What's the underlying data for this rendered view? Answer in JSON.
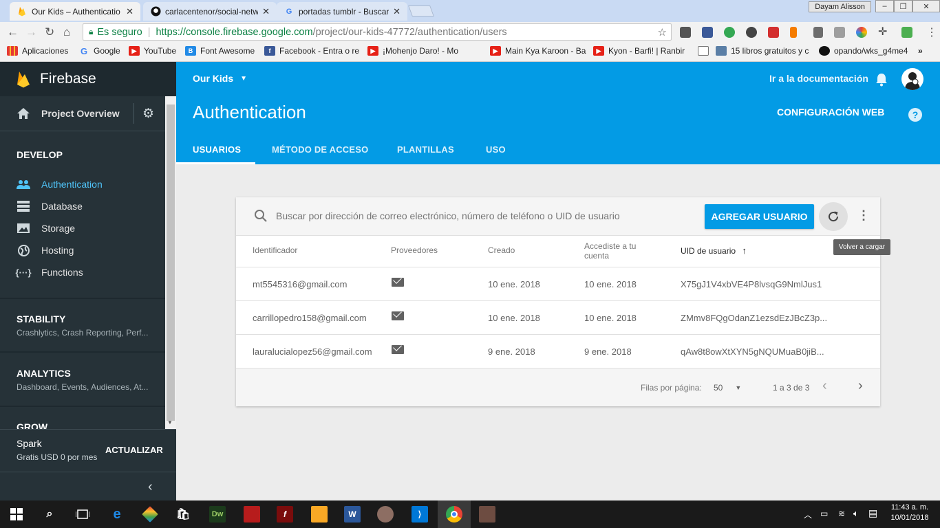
{
  "browser": {
    "tabs": [
      {
        "title": "Our Kids – Authenticatio",
        "active": true
      },
      {
        "title": "carlacentenor/social-netw",
        "active": false
      },
      {
        "title": "portadas tumblr - Buscar",
        "active": false
      }
    ],
    "user_button": "Dayam Alisson",
    "address": {
      "secure_label": "Es seguro",
      "url_host": "https://console.firebase.google.com",
      "url_path": "/project/our-kids-47772/authentication/users"
    },
    "bookmarks": [
      {
        "label": "Aplicaciones",
        "icon": "apps-grid-icon"
      },
      {
        "label": "Google",
        "icon": "google-icon"
      },
      {
        "label": "YouTube",
        "icon": "youtube-icon"
      },
      {
        "label": "Font Awesome",
        "icon": "font-awesome-icon"
      },
      {
        "label": "Facebook - Entra o re",
        "icon": "facebook-icon"
      },
      {
        "label": "¡Mohenjo Daro! - Mo",
        "icon": "youtube-icon"
      },
      {
        "label": "Main Kya Karoon - Ba",
        "icon": "youtube-icon"
      },
      {
        "label": "Kyon - Barfi! | Ranbir",
        "icon": "youtube-icon"
      },
      {
        "label": "",
        "icon": "page-icon"
      },
      {
        "label": "15 libros gratuitos y c",
        "icon": "book-icon"
      },
      {
        "label": "opando/wks_g4me4",
        "icon": "github-icon"
      }
    ],
    "more_bookmarks": "»"
  },
  "sidebar": {
    "brand": "Firebase",
    "overview": "Project Overview",
    "develop_title": "DEVELOP",
    "develop_items": [
      {
        "label": "Authentication",
        "icon": "people-icon",
        "active": true
      },
      {
        "label": "Database",
        "icon": "database-icon",
        "active": false
      },
      {
        "label": "Storage",
        "icon": "image-icon",
        "active": false
      },
      {
        "label": "Hosting",
        "icon": "globe-icon",
        "active": false
      },
      {
        "label": "Functions",
        "icon": "functions-icon",
        "active": false
      }
    ],
    "stability": {
      "title": "STABILITY",
      "sub": "Crashlytics, Crash Reporting, Perf..."
    },
    "analytics": {
      "title": "ANALYTICS",
      "sub": "Dashboard, Events, Audiences, At..."
    },
    "grow": {
      "title": "GROW"
    },
    "plan": {
      "name": "Spark",
      "price": "Gratis USD 0 por mes",
      "upgrade": "ACTUALIZAR"
    }
  },
  "header": {
    "project": "Our Kids",
    "docs_link": "Ir a la documentación",
    "title": "Authentication",
    "web_config": "CONFIGURACIÓN WEB",
    "tabs": [
      "USUARIOS",
      "MÉTODO DE ACCESO",
      "PLANTILLAS",
      "USO"
    ],
    "active_tab": 0
  },
  "users": {
    "search_placeholder": "Buscar por dirección de correo electrónico, número de teléfono o UID de usuario",
    "add_user": "AGREGAR USUARIO",
    "reload_tooltip": "Volver a cargar",
    "columns": {
      "id": "Identificador",
      "providers": "Proveedores",
      "created": "Creado",
      "signed_in_1": "Accediste a tu",
      "signed_in_2": "cuenta",
      "uid": "UID de usuario"
    },
    "rows": [
      {
        "email": "mt5545316@gmail.com",
        "created": "10 ene. 2018",
        "signed_in": "10 ene. 2018",
        "uid": "X75gJ1V4xbVE4P8lvsqG9NmlJus1"
      },
      {
        "email": "carrillopedro158@gmail.com",
        "created": "10 ene. 2018",
        "signed_in": "10 ene. 2018",
        "uid": "ZMmv8FQgOdanZ1ezsdEzJBcZ3p..."
      },
      {
        "email": "lauralucialopez56@gmail.com",
        "created": "9 ene. 2018",
        "signed_in": "9 ene. 2018",
        "uid": "qAw8t8owXtXYN5gNQUMuaB0jiB..."
      }
    ],
    "pagination": {
      "rows_label": "Filas por página:",
      "rows_value": "50",
      "range": "1 a 3 de 3"
    }
  },
  "taskbar": {
    "time": "11:43 a. m.",
    "date": "10/01/2018"
  },
  "colors": {
    "firebase_blue": "#039be5",
    "sidebar_bg": "#263238",
    "active_link": "#4fc3f7"
  }
}
